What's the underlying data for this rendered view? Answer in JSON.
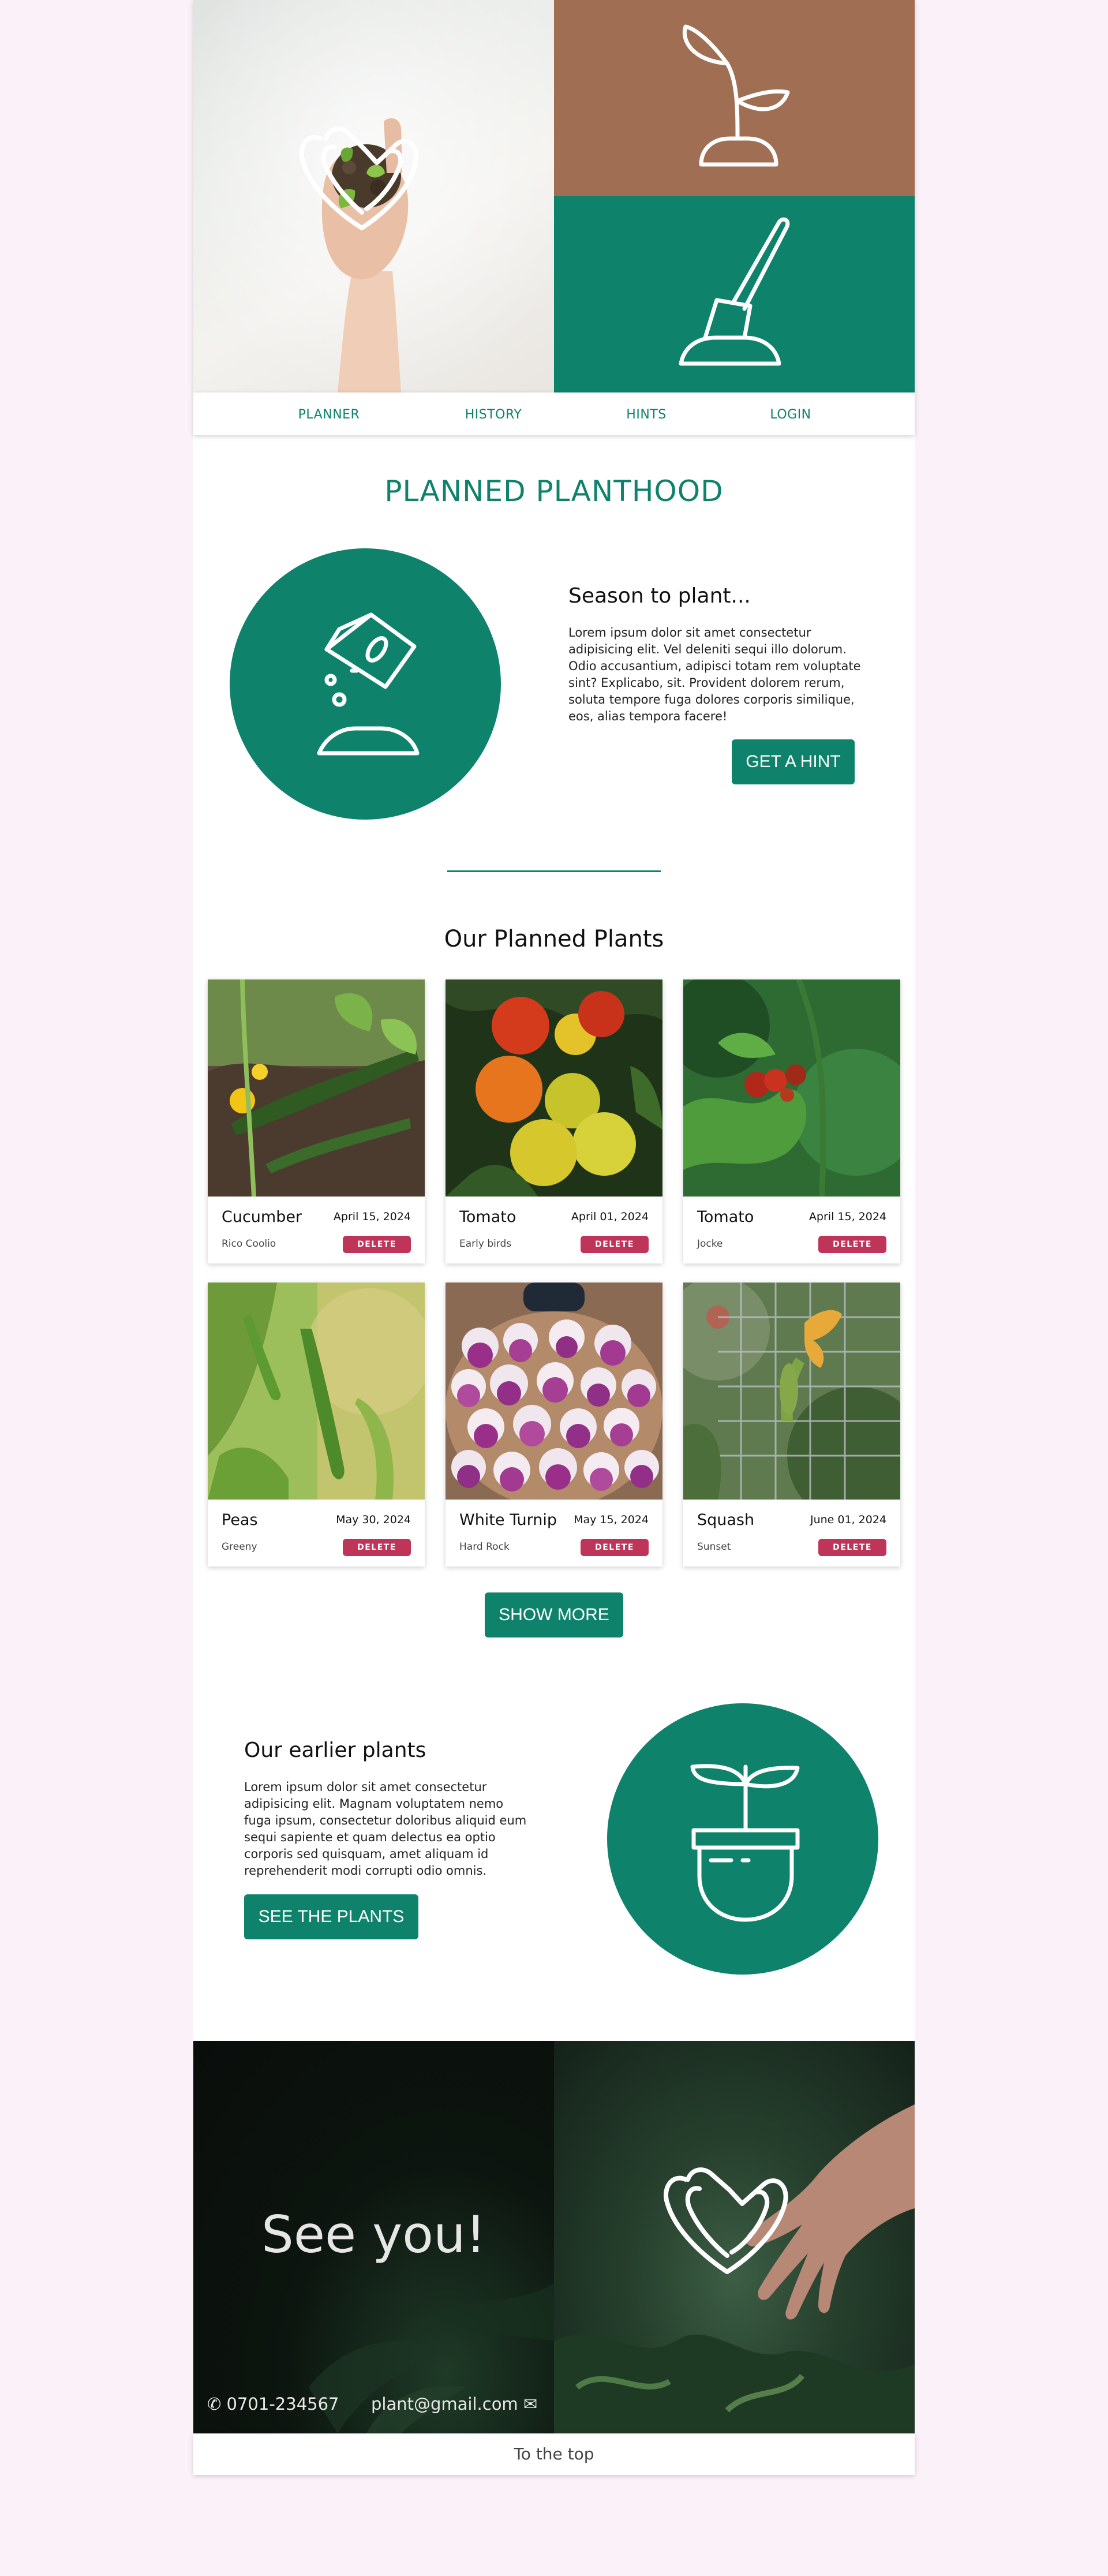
{
  "colors": {
    "accent": "#0e826b",
    "brown": "#a06e53",
    "danger": "#bf3459",
    "background": "#fbf1f9"
  },
  "nav": {
    "items": [
      {
        "label": "PLANNER"
      },
      {
        "label": "HISTORY"
      },
      {
        "label": "HINTS"
      },
      {
        "label": "LOGIN"
      }
    ]
  },
  "hero": {
    "icons": [
      "heart-plant-logo-icon",
      "sprout-icon",
      "shovel-icon"
    ]
  },
  "main": {
    "title": "PLANNED PLANTHOOD",
    "season": {
      "heading": "Season to plant...",
      "text": "Lorem ipsum dolor sit amet consectetur adipisicing elit. Vel deleniti sequi illo dolorum. Odio accusantium, adipisci totam rem voluptate sint? Explicabo, sit. Provident dolorem rerum, soluta tempore fuga dolores corporis similique, eos, alias tempora facere!",
      "button": "GET A HINT",
      "icon": "seed-bag-icon"
    },
    "planned": {
      "heading": "Our Planned Plants",
      "delete_label": "DELETE",
      "plants": [
        {
          "name": "Cucumber",
          "date": "April 15, 2024",
          "owner": "Rico Coolio"
        },
        {
          "name": "Tomato",
          "date": "April 01, 2024",
          "owner": "Early birds"
        },
        {
          "name": "Tomato",
          "date": "April 15, 2024",
          "owner": "Jocke"
        },
        {
          "name": "Peas",
          "date": "May 30, 2024",
          "owner": "Greeny"
        },
        {
          "name": "White Turnip",
          "date": "May 15, 2024",
          "owner": "Hard Rock"
        },
        {
          "name": "Squash",
          "date": "June 01, 2024",
          "owner": "Sunset"
        }
      ],
      "show_more": "SHOW MORE"
    },
    "earlier": {
      "heading": "Our earlier plants",
      "text": "Lorem ipsum dolor sit amet consectetur adipisicing elit. Magnam voluptatem nemo fuga ipsum, consectetur doloribus aliquid eum sequi sapiente et quam delectus ea optio corporis sed quisquam, amet aliquam id reprehenderit modi corrupti odio omnis.",
      "button": "SEE THE PLANTS",
      "icon": "potted-plant-icon"
    }
  },
  "footer": {
    "farewell": "See you!",
    "phone": "0701-234567",
    "email": "plant@gmail.com",
    "to_top": "To the top"
  }
}
